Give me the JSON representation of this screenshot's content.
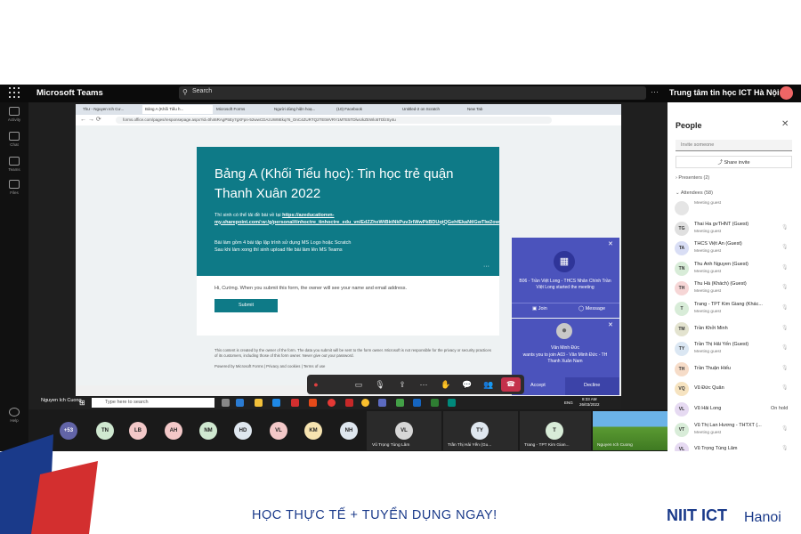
{
  "teams": {
    "app_title": "Microsoft Teams",
    "search_placeholder": "Search",
    "org_name": "Trung tâm tin học ICT Hà Nội",
    "org_avatar": "T",
    "rail": [
      "Activity",
      "Chat",
      "Teams",
      "Files",
      "Help"
    ]
  },
  "browser": {
    "tabs": [
      "Thư - Nguyen Ich Cư...",
      "Bảng A (Khối Tiểu h...",
      "Microsoft Forms",
      "Người dùng hiện hoạ...",
      "(10) Facebook",
      "Untitled-2 on Scratch",
      "New Tab"
    ],
    "url": "forms.office.com/pages/responsepage.aspx?id=0h46RAgP5Ey7gXFpn-52wwCDAzUW9Ekq76_OnC4ZURTQ2TEtWVRY1MTE5TDlwUkZEWlo5TDlzSy4u"
  },
  "form": {
    "title": "Bảng A (Khối Tiểu học): Tin học trẻ quận Thanh Xuân 2022",
    "line1": "Thí sinh có thể tải đề bài về tại",
    "link_text": "https://azeducationvn-my.sharepoint.com/:w:/g/personal/tinhoctre_tinhoctre_edu_vn/EdZZhxWtBktNkPuv3rlWwPkBDUqtQGehfEkaNtlGwTIw2ow",
    "line2": "Bài làm gồm 4 bài tập lập trình sử dụng MS Logo hoặc Scratch",
    "line3": "Sau khi làm xong thí sinh upload file bài làm lên MS Teams",
    "note": "Hi, Cường. When you submit this form, the owner will see your name and email address.",
    "submit_label": "Submit",
    "disclaimer": "This content is created by the owner of the form. The data you submit will be sent to the form owner. Microsoft is not responsible for the privacy or security practices of its customers, including those of this form owner. Never give out your password.",
    "powered": "Powered by Microsoft Forms | Privacy and cookies | Terms of use"
  },
  "notifications": [
    {
      "text": "B06 - Trần Việt Long - THCS Nhân Chính Trần Việt Long started the meeting",
      "btn1": "Join",
      "btn2": "Message"
    },
    {
      "name": "Văn Minh Đức",
      "text": "wants you to join A03 - Văn Minh Đức - TH Thanh Xuân Nam",
      "btn1": "Accept",
      "btn2": "Decline"
    }
  ],
  "taskbar": {
    "user_label": "Nguyen Ich Cuong",
    "search": "Type here to search",
    "lang": "ENG",
    "time": "8:33 AM",
    "date": "26/03/2022"
  },
  "people": {
    "title": "People",
    "invite_placeholder": "Invite someone",
    "share_invite": "Share invite",
    "presenters": "Presenters (2)",
    "attendees": "Attendees (58)",
    "list": [
      {
        "initials": "",
        "name": "",
        "role": "Meeting guest",
        "color": "#e5e5e5"
      },
      {
        "initials": "TG",
        "name": "Thai Ha gvTHNT (Guest)",
        "role": "Meeting guest",
        "color": "#e0e0e0"
      },
      {
        "initials": "TA",
        "name": "THCS Việt An (Guest)",
        "role": "Meeting guest",
        "color": "#d9def5"
      },
      {
        "initials": "TN",
        "name": "Thu Anh Nguyen (Guest)",
        "role": "Meeting guest",
        "color": "#d8ecd8"
      },
      {
        "initials": "TH",
        "name": "Thu Hà (Khách) (Guest)",
        "role": "Meeting guest",
        "color": "#f6d6d6"
      },
      {
        "initials": "T",
        "name": "Trang - TPT Kim Giang (Khác...",
        "role": "Meeting guest",
        "color": "#d8ecd8"
      },
      {
        "initials": "TM",
        "name": "Trần Khởi Minh",
        "role": "",
        "color": "#e3e3cf"
      },
      {
        "initials": "TY",
        "name": "Trần Thị Hải Yến (Guest)",
        "role": "Meeting guest",
        "color": "#dbe7f3"
      },
      {
        "initials": "TH",
        "name": "Trần Thuận Hiếu",
        "role": "",
        "color": "#f6dcc8"
      },
      {
        "initials": "VQ",
        "name": "Vũ Đức Quân",
        "role": "",
        "color": "#f6e3c0"
      },
      {
        "initials": "VL",
        "name": "Vũ Hải Long",
        "role": "",
        "color": "#e6daf2",
        "status": "On hold"
      },
      {
        "initials": "VT",
        "name": "Vũ Thị Lan Hương - THTXT (...",
        "role": "Meeting guest",
        "color": "#d8ecd8"
      },
      {
        "initials": "VL",
        "name": "Vũ Trọng Tùng Lâm",
        "role": "",
        "color": "#e6daf2"
      }
    ]
  },
  "gallery": {
    "more": "+53",
    "avatars": [
      {
        "initials": "TN",
        "color": "#cfe8d0"
      },
      {
        "initials": "LB",
        "color": "#f3c8c8"
      },
      {
        "initials": "AH",
        "color": "#f3c8c8"
      },
      {
        "initials": "NM",
        "color": "#cfe8d0"
      },
      {
        "initials": "HD",
        "color": "#dfe7ef"
      },
      {
        "initials": "VL",
        "color": "#f3c8c8"
      },
      {
        "initials": "KM",
        "color": "#f6e3b0"
      },
      {
        "initials": "NH",
        "color": "#dfe7ef"
      }
    ],
    "tiles": [
      {
        "initials": "VL",
        "caption": "Vũ Trọng Tùng Lâm",
        "color": "#d7d7d7"
      },
      {
        "initials": "TY",
        "caption": "Trần Thị Hải Yến (Gu...",
        "color": "#dfe7ef"
      },
      {
        "initials": "T",
        "caption": "Trang - TPT Kim Gian...",
        "color": "#d8ecd8"
      }
    ],
    "video_caption": "Nguyen Ich Cuong"
  },
  "banner": {
    "tagline": "HỌC THỰC TẾ + TUYỂN DỤNG NGAY!",
    "brand": "NIIT ICT",
    "brand_sub": "Hanoi"
  }
}
